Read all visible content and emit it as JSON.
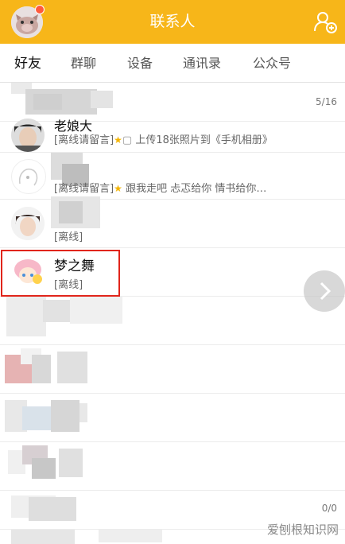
{
  "header": {
    "title": "联系人"
  },
  "tabs": [
    "好友",
    "群聊",
    "设备",
    "通讯录",
    "公众号"
  ],
  "groups": [
    {
      "count": "5/16"
    },
    {
      "count": "0/0"
    }
  ],
  "contacts": [
    {
      "name": "老娘大",
      "status": "[离线请留言]",
      "note": "上传18张照片到《手机相册》"
    },
    {
      "name": "",
      "status": "[离线请留言]",
      "note": "跟我走吧 忐忑给你 情书给你…"
    },
    {
      "name": "",
      "status": "[离线]",
      "note": ""
    },
    {
      "name": "梦之舞",
      "status": "[离线]",
      "note": ""
    }
  ],
  "watermark": "爱刨根知识网",
  "colors": {
    "header": "#f7b619",
    "highlight": "#e1251b"
  }
}
